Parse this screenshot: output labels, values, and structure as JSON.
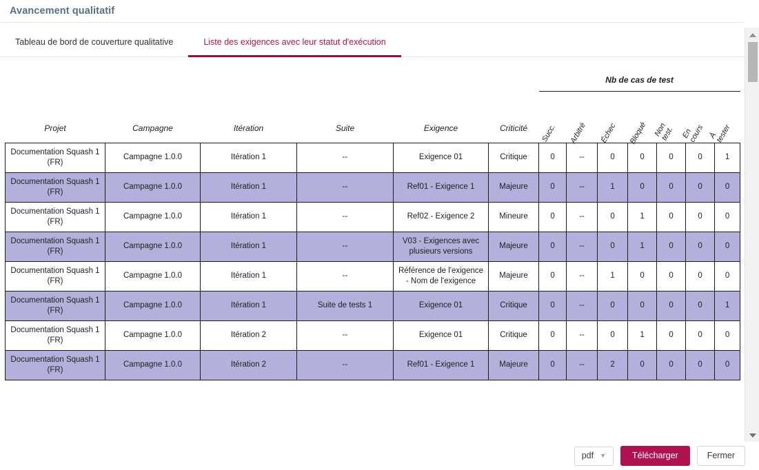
{
  "header": {
    "title": "Avancement qualitatif"
  },
  "tabs": [
    {
      "label": "Tableau de bord de couverture qualitative",
      "active": false
    },
    {
      "label": "Liste des exigences avec leur statut d'exécution",
      "active": true
    }
  ],
  "table": {
    "group_header": "Nb de cas de test",
    "columns": [
      "Projet",
      "Campagne",
      "Itération",
      "Suite",
      "Exigence",
      "Criticité"
    ],
    "rotated_columns": [
      "Succ.",
      "Arbitré",
      "Échec",
      "Bloqué",
      "Non\ntest.",
      "En\ncours",
      "À\ntester"
    ],
    "rows": [
      {
        "projet": "Documentation Squash 1 (FR)",
        "campagne": "Campagne 1.0.0",
        "iteration": "Itération 1",
        "suite": "--",
        "exigence": "Exigence 01",
        "criticite": "Critique",
        "succ": "0",
        "arbitre": "--",
        "echec": "0",
        "bloque": "0",
        "non_test": "0",
        "en_cours": "0",
        "a_tester": "1",
        "highlight": false
      },
      {
        "projet": "Documentation Squash 1 (FR)",
        "campagne": "Campagne 1.0.0",
        "iteration": "Itération 1",
        "suite": "--",
        "exigence": "Ref01 - Exigence 1",
        "criticite": "Majeure",
        "succ": "0",
        "arbitre": "--",
        "echec": "1",
        "bloque": "0",
        "non_test": "0",
        "en_cours": "0",
        "a_tester": "0",
        "highlight": true
      },
      {
        "projet": "Documentation Squash 1 (FR)",
        "campagne": "Campagne 1.0.0",
        "iteration": "Itération 1",
        "suite": "--",
        "exigence": "Ref02 - Exigence 2",
        "criticite": "Mineure",
        "succ": "0",
        "arbitre": "--",
        "echec": "0",
        "bloque": "1",
        "non_test": "0",
        "en_cours": "0",
        "a_tester": "0",
        "highlight": false
      },
      {
        "projet": "Documentation Squash 1 (FR)",
        "campagne": "Campagne 1.0.0",
        "iteration": "Itération 1",
        "suite": "--",
        "exigence": "V03 - Exigences avec plusieurs versions",
        "criticite": "Majeure",
        "succ": "0",
        "arbitre": "--",
        "echec": "0",
        "bloque": "1",
        "non_test": "0",
        "en_cours": "0",
        "a_tester": "0",
        "highlight": true
      },
      {
        "projet": "Documentation Squash 1 (FR)",
        "campagne": "Campagne 1.0.0",
        "iteration": "Itération 1",
        "suite": "--",
        "exigence": "Référence de l'exigence - Nom de l'exigence",
        "criticite": "Majeure",
        "succ": "0",
        "arbitre": "--",
        "echec": "1",
        "bloque": "0",
        "non_test": "0",
        "en_cours": "0",
        "a_tester": "0",
        "highlight": false
      },
      {
        "projet": "Documentation Squash 1 (FR)",
        "campagne": "Campagne 1.0.0",
        "iteration": "Itération 1",
        "suite": "Suite de tests 1",
        "exigence": "Exigence 01",
        "criticite": "Critique",
        "succ": "0",
        "arbitre": "--",
        "echec": "0",
        "bloque": "0",
        "non_test": "0",
        "en_cours": "0",
        "a_tester": "1",
        "highlight": true
      },
      {
        "projet": "Documentation Squash 1 (FR)",
        "campagne": "Campagne 1.0.0",
        "iteration": "Itération 2",
        "suite": "--",
        "exigence": "Exigence 01",
        "criticite": "Critique",
        "succ": "0",
        "arbitre": "--",
        "echec": "0",
        "bloque": "1",
        "non_test": "0",
        "en_cours": "0",
        "a_tester": "0",
        "highlight": false
      },
      {
        "projet": "Documentation Squash 1 (FR)",
        "campagne": "Campagne 1.0.0",
        "iteration": "Itération 2",
        "suite": "--",
        "exigence": "Ref01 - Exigence 1",
        "criticite": "Majeure",
        "succ": "0",
        "arbitre": "--",
        "echec": "2",
        "bloque": "0",
        "non_test": "0",
        "en_cours": "0",
        "a_tester": "0",
        "highlight": true
      }
    ]
  },
  "footer": {
    "format_value": "pdf",
    "caret_icon": "chevron-down-icon",
    "download_label": "Télécharger",
    "close_label": "Fermer"
  },
  "colors": {
    "accent": "#b0124f",
    "accent_underline": "#9e0b44",
    "row_highlight": "#b3b0db",
    "title": "#5b6e7f"
  }
}
